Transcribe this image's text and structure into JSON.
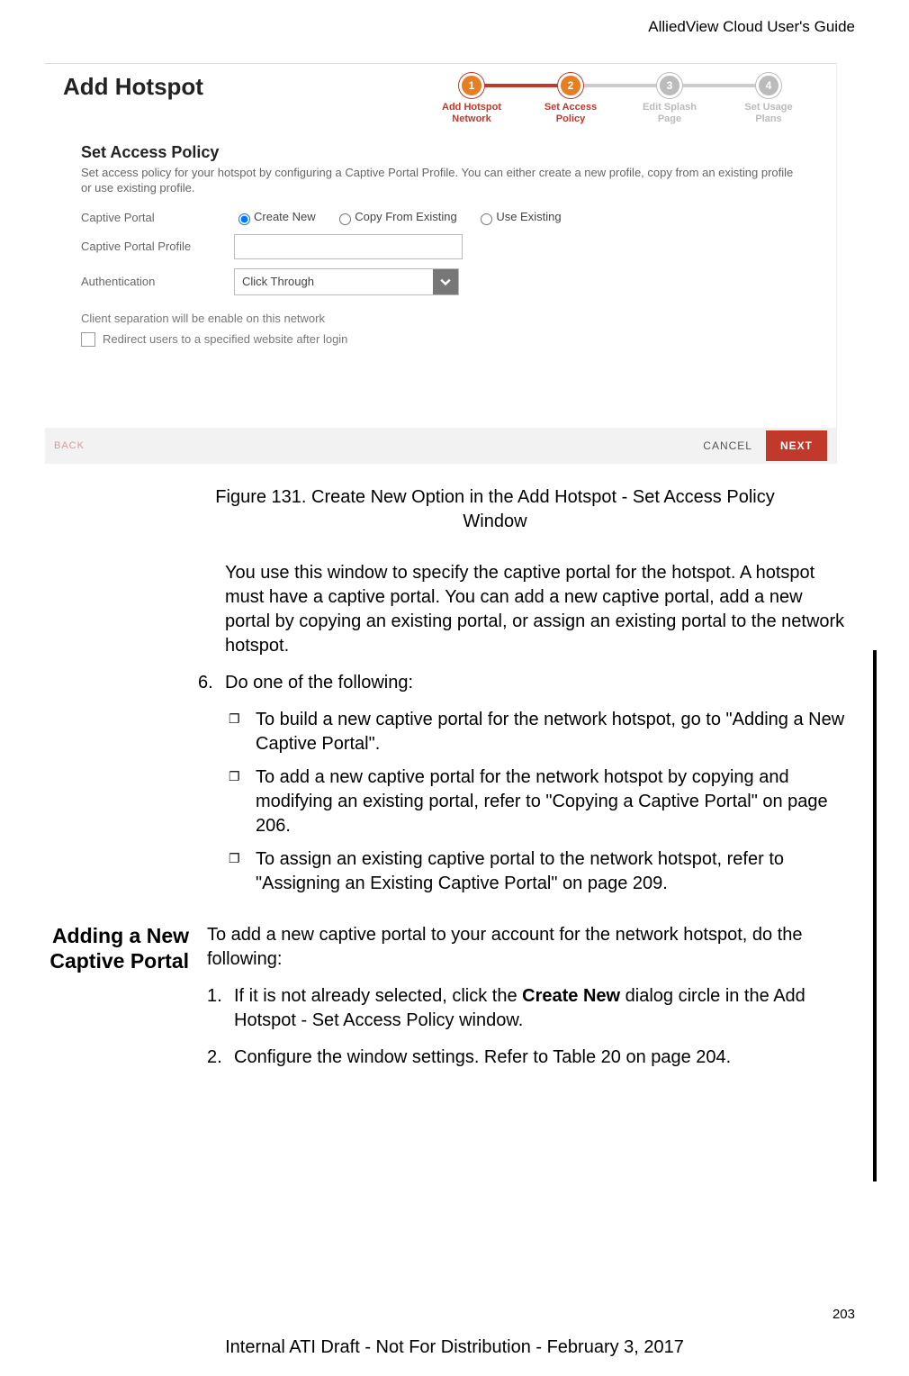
{
  "header": {
    "doc_title": "AlliedView Cloud User's Guide"
  },
  "screenshot": {
    "title": "Add Hotspot",
    "steps": [
      {
        "num": "1",
        "label_l1": "Add Hotspot",
        "label_l2": "Network",
        "state": "active"
      },
      {
        "num": "2",
        "label_l1": "Set Access",
        "label_l2": "Policy",
        "state": "active"
      },
      {
        "num": "3",
        "label_l1": "Edit Splash",
        "label_l2": "Page",
        "state": "inactive"
      },
      {
        "num": "4",
        "label_l1": "Set Usage",
        "label_l2": "Plans",
        "state": "inactive"
      }
    ],
    "policy_title": "Set Access Policy",
    "policy_desc": "Set access policy for your hotspot by configuring a Captive Portal Profile. You can either create a new profile, copy from an existing profile or use existing profile.",
    "labels": {
      "captive_portal": "Captive Portal",
      "captive_portal_profile": "Captive Portal Profile",
      "authentication": "Authentication"
    },
    "radios": {
      "create_new": "Create New",
      "copy_from": "Copy From Existing",
      "use_existing": "Use Existing"
    },
    "auth_value": "Click Through",
    "note": "Client separation will be enable on this network",
    "checkbox_label": "Redirect users to a specified website after login",
    "buttons": {
      "back": "BACK",
      "cancel": "CANCEL",
      "next": "NEXT"
    }
  },
  "content": {
    "figure_caption": "Figure 131. Create New Option in the Add Hotspot - Set Access Policy Window",
    "intro_para": "You use this window to specify the captive portal for the hotspot. A hotspot must have a captive portal. You can add a new captive portal, add a new portal by copying an existing portal, or assign an existing portal to the network hotspot.",
    "step6_num": "6.",
    "step6_text": "Do one of the following:",
    "bullets": [
      "To build a new captive portal for the network hotspot, go to \"Adding a New Captive Portal\".",
      "To add a new captive portal for the network hotspot by copying and modifying an existing portal, refer to \"Copying a Captive Portal\" on page 206.",
      "To assign an existing captive portal to the network hotspot, refer to \"Assigning an Existing Captive Portal\" on page 209."
    ],
    "side_heading": "Adding a New Captive Portal",
    "section_intro": "To add a new captive portal to your account for the network hotspot, do the following:",
    "s1_num": "1.",
    "s1_pre": "If it is not already selected, click the ",
    "s1_bold": "Create New",
    "s1_post": " dialog circle in the Add Hotspot - Set Access Policy window.",
    "s2_num": "2.",
    "s2_text": "Configure the window settings. Refer to Table 20 on page 204."
  },
  "footer": {
    "page_number": "203",
    "text": "Internal ATI Draft - Not For Distribution - February 3, 2017"
  }
}
